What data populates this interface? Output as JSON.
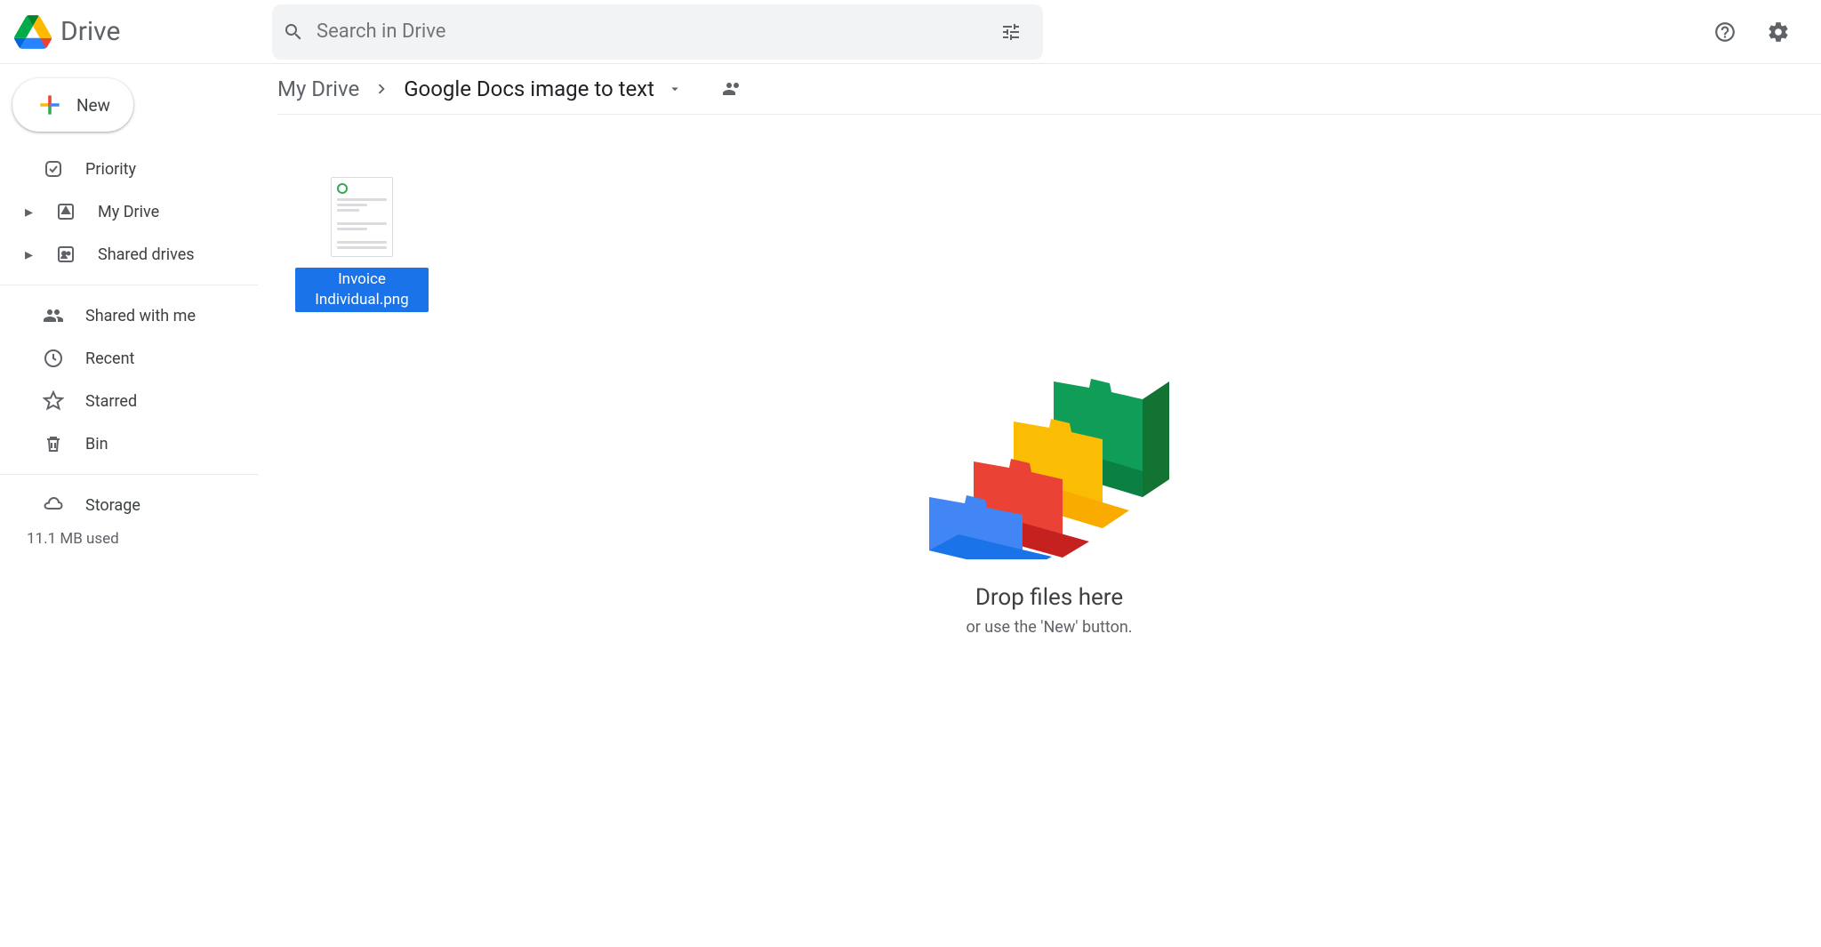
{
  "app": {
    "name": "Drive"
  },
  "search": {
    "placeholder": "Search in Drive"
  },
  "new_button": "New",
  "sidebar": {
    "items": [
      {
        "label": "Priority"
      },
      {
        "label": "My Drive"
      },
      {
        "label": "Shared drives"
      },
      {
        "label": "Shared with me"
      },
      {
        "label": "Recent"
      },
      {
        "label": "Starred"
      },
      {
        "label": "Bin"
      },
      {
        "label": "Storage"
      }
    ],
    "storage_used": "11.1 MB used"
  },
  "breadcrumb": {
    "root": "My Drive",
    "current": "Google Docs image to text"
  },
  "files": [
    {
      "name": "Invoice Individual.png"
    }
  ],
  "dropzone": {
    "title": "Drop files here",
    "subtitle": "or use the 'New' button."
  }
}
